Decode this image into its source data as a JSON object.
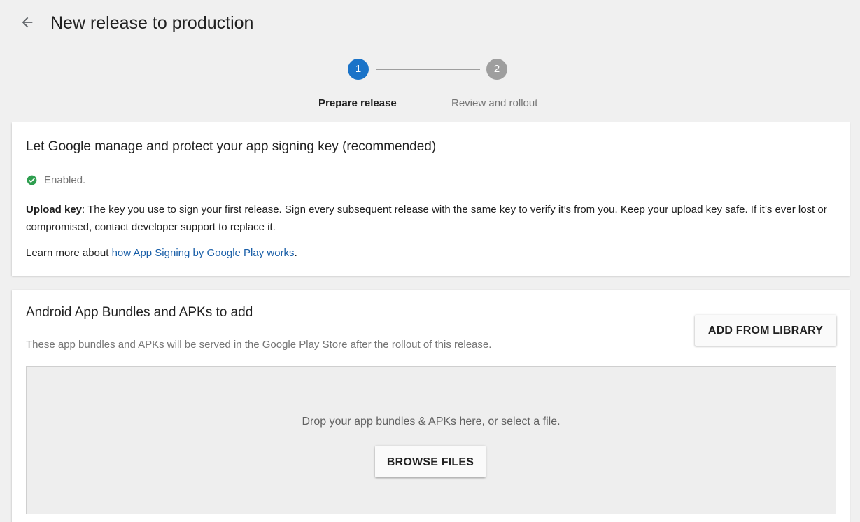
{
  "header": {
    "title": "New release to production",
    "back_icon": "arrow-left-icon"
  },
  "stepper": {
    "steps": [
      {
        "number": "1",
        "label": "Prepare release",
        "active": true
      },
      {
        "number": "2",
        "label": "Review and rollout",
        "active": false
      }
    ]
  },
  "signing": {
    "title": "Let Google manage and protect your app signing key (recommended)",
    "status": "Enabled.",
    "status_icon": "check-circle-icon",
    "upload_key_label": "Upload key",
    "upload_key_text": ": The key you use to sign your first release. Sign every subsequent release with the same key to verify it’s from you. Keep your upload key safe. If it’s ever lost or compromised, contact developer support to replace it.",
    "learn_more_prefix": "Learn more about ",
    "learn_more_link": "how App Signing by Google Play works",
    "learn_more_suffix": "."
  },
  "bundles": {
    "title": "Android App Bundles and APKs to add",
    "subtitle": "These app bundles and APKs will be served in the Google Play Store after the rollout of this release.",
    "add_from_library_label": "ADD FROM LIBRARY",
    "dropzone_text": "Drop your app bundles & APKs here, or select a file.",
    "browse_label": "BROWSE FILES"
  },
  "colors": {
    "primary": "#1a73c8",
    "link": "#1a5fa8",
    "success": "#2e9e4f",
    "inactive_step": "#9e9e9e",
    "background": "#f0f0f0"
  }
}
